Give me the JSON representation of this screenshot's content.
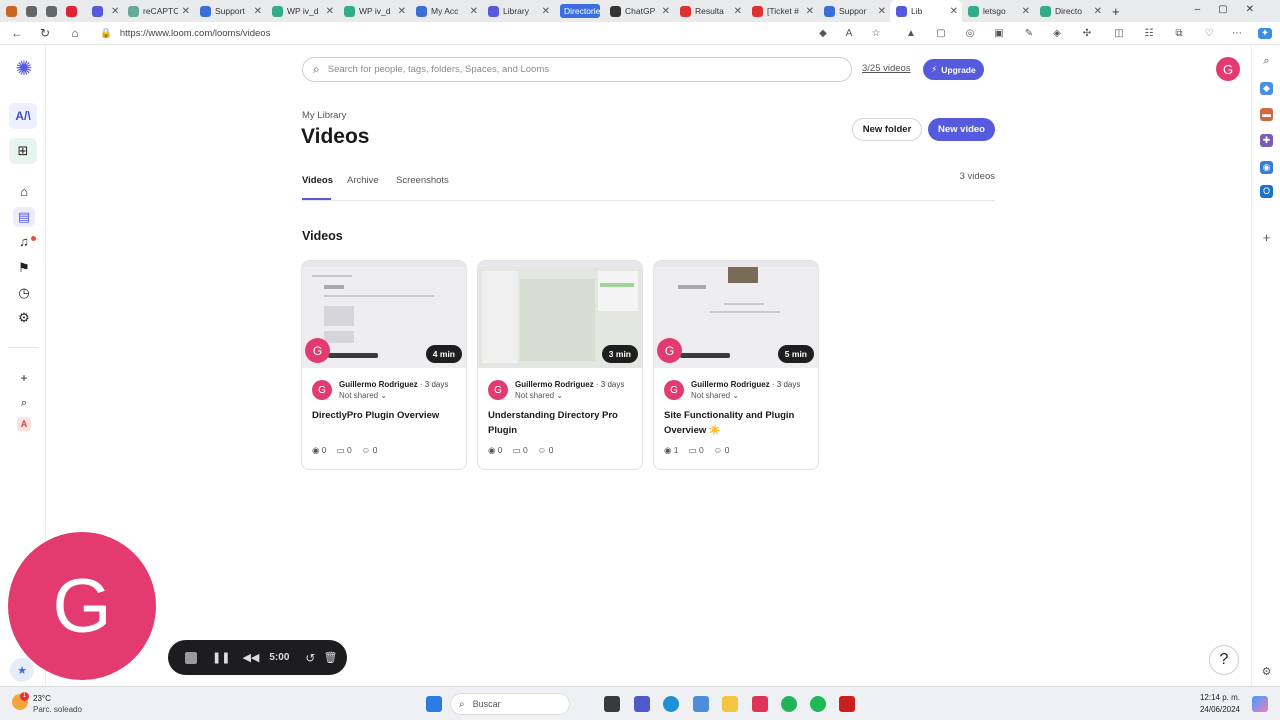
{
  "browser": {
    "tabs": [
      {
        "title": "",
        "x": false
      },
      {
        "title": "",
        "x": false
      },
      {
        "title": "",
        "x": false
      },
      {
        "title": "",
        "x": true
      },
      {
        "title": "",
        "x": true
      },
      {
        "title": "reCAPTC",
        "x": true
      },
      {
        "title": "Support",
        "x": true
      },
      {
        "title": "WP iv_d",
        "x": true
      },
      {
        "title": "WP iv_d",
        "x": true
      },
      {
        "title": "My Acc",
        "x": true
      },
      {
        "title": "Library",
        "x": true
      },
      {
        "title": "Directories",
        "x": false
      },
      {
        "title": "ChatGP",
        "x": true
      },
      {
        "title": "Resulta",
        "x": true
      },
      {
        "title": "[Ticket #",
        "x": true
      },
      {
        "title": "Suppor",
        "x": true
      },
      {
        "title": "Lib",
        "x": true
      },
      {
        "title": "letsgo",
        "x": true
      },
      {
        "title": "Directo",
        "x": true
      }
    ],
    "url": "https://www.loom.com/looms/videos"
  },
  "header": {
    "search_placeholder": "Search for people, tags, folders, Spaces, and Looms",
    "quota": "3/25 videos",
    "upgrade": "Upgrade",
    "avatar_letter": "G"
  },
  "page": {
    "breadcrumb": "My Library",
    "title": "Videos",
    "new_folder": "New folder",
    "new_video": "New video",
    "tabs": [
      "Videos",
      "Archive",
      "Screenshots"
    ],
    "count": "3 videos",
    "section_title": "Videos"
  },
  "videos": [
    {
      "duration": "4 min",
      "author": "Guillermo Rodriguez",
      "age": "3 days",
      "sharing": "Not shared",
      "title": "DirectlyPro Plugin Overview",
      "views": "0",
      "comments": "0",
      "reactions": "0"
    },
    {
      "duration": "3 min",
      "author": "Guillermo Rodriguez",
      "age": "3 days",
      "sharing": "Not shared",
      "title": "Understanding Directory Pro Plugin",
      "views": "0",
      "comments": "0",
      "reactions": "0"
    },
    {
      "duration": "5 min",
      "author": "Guillermo Rodriguez",
      "age": "3 days",
      "sharing": "Not shared",
      "title": "Site Functionality and Plugin Overview ☀️",
      "views": "1",
      "comments": "0",
      "reactions": "0"
    }
  ],
  "recorder": {
    "avatar_letter": "G",
    "time": "5:00"
  },
  "help": "?",
  "taskbar": {
    "weather_temp": "23°C",
    "weather_desc": "Parc. soleado",
    "search": "Buscar",
    "time": "12:14 p. m.",
    "date": "24/06/2024"
  },
  "colors": {
    "accent": "#565ADD",
    "avatar": "#e33b6f"
  }
}
